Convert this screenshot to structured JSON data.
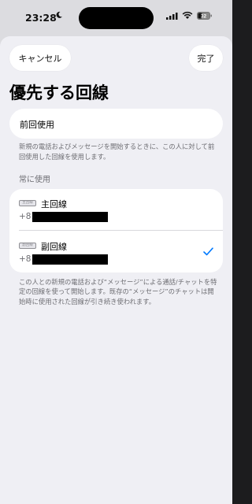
{
  "status_bar": {
    "time": "23:28",
    "battery": "32"
  },
  "nav": {
    "cancel_label": "キャンセル",
    "done_label": "完了"
  },
  "page": {
    "title": "優先する回線"
  },
  "recent": {
    "label": "前回使用",
    "note": "新規の電話およびメッセージを開始するときに、この人に対して前回使用した回線を使用します。"
  },
  "always": {
    "header": "常に使用",
    "lines": [
      {
        "badge": "主回線",
        "name": "主回線",
        "number_prefix": "+81",
        "selected": false
      },
      {
        "badge": "副回線",
        "name": "副回線",
        "number_prefix": "+81",
        "selected": true
      }
    ],
    "note": "この人との新規の電話および“メッセージ”による通話/チャットを特定の回線を使って開始します。既存の“メッセージ”のチャットは開始時に使用された回線が引き続き使われます。"
  },
  "colors": {
    "accent": "#007aff",
    "sheet_bg": "#efeff4",
    "card_bg": "#ffffff",
    "secondary_text": "#6d6d72"
  }
}
